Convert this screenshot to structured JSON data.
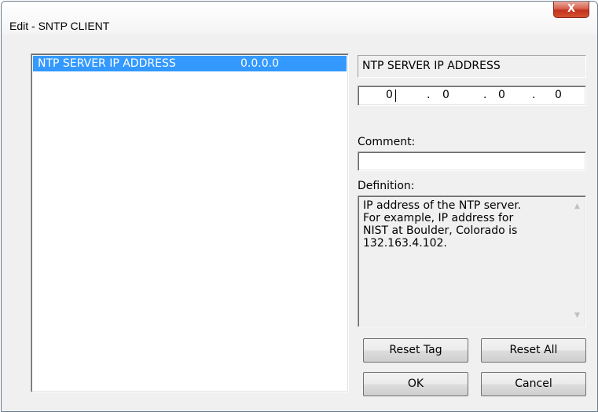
{
  "window": {
    "title": "Edit - SNTP CLIENT",
    "close_label": "X"
  },
  "list": {
    "items": [
      {
        "name": "NTP SERVER IP ADDRESS",
        "value": "0.0.0.0",
        "selected": true
      }
    ]
  },
  "editor": {
    "tag_name": "NTP SERVER IP ADDRESS",
    "ip_octets": [
      "0",
      "0",
      "0",
      "0"
    ],
    "ip_separator": ".",
    "comment_label": "Comment:",
    "comment_value": "",
    "definition_label": "Definition:",
    "definition_text": "IP address of the NTP server.\nFor example, IP address for\nNIST at Boulder, Colorado is\n132.163.4.102."
  },
  "buttons": {
    "reset_tag": "Reset Tag",
    "reset_all": "Reset All",
    "ok": "OK",
    "cancel": "Cancel"
  },
  "colors": {
    "selection": "#3399ff",
    "close_button": "#c2321f"
  }
}
